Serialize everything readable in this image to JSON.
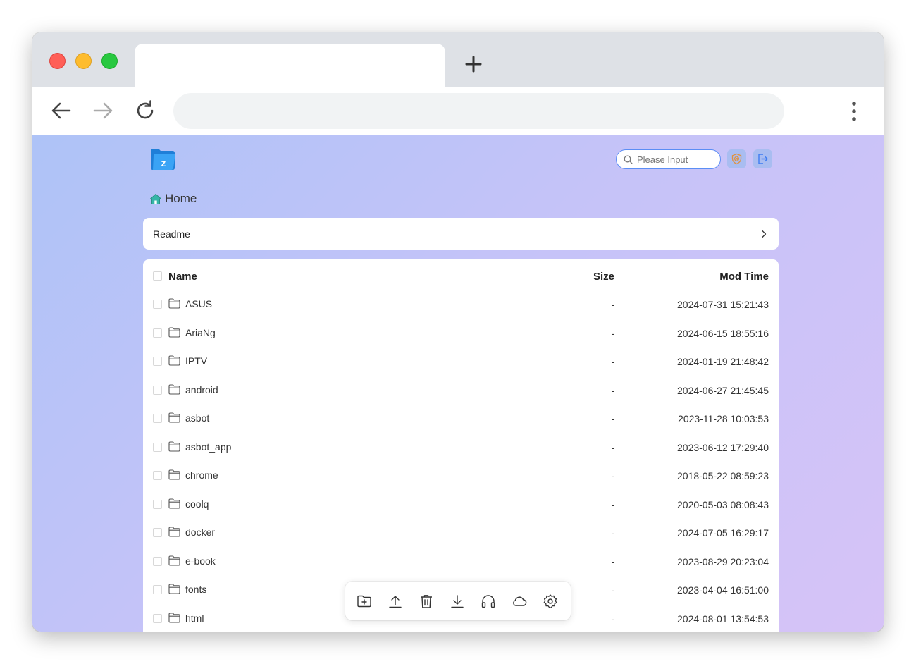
{
  "browser": {
    "tab_title": "",
    "address": ""
  },
  "app": {
    "search_placeholder": "Please Input",
    "logo_letter": "z",
    "breadcrumb_home": "Home",
    "readme_label": "Readme"
  },
  "table": {
    "headers": {
      "name": "Name",
      "size": "Size",
      "modified": "Mod Time"
    },
    "rows": [
      {
        "name": "ASUS",
        "size": "-",
        "modified": "2024-07-31 15:21:43"
      },
      {
        "name": "AriaNg",
        "size": "-",
        "modified": "2024-06-15 18:55:16"
      },
      {
        "name": "IPTV",
        "size": "-",
        "modified": "2024-01-19 21:48:42"
      },
      {
        "name": "android",
        "size": "-",
        "modified": "2024-06-27 21:45:45"
      },
      {
        "name": "asbot",
        "size": "-",
        "modified": "2023-11-28 10:03:53"
      },
      {
        "name": "asbot_app",
        "size": "-",
        "modified": "2023-06-12 17:29:40"
      },
      {
        "name": "chrome",
        "size": "-",
        "modified": "2018-05-22 08:59:23"
      },
      {
        "name": "coolq",
        "size": "-",
        "modified": "2020-05-03 08:08:43"
      },
      {
        "name": "docker",
        "size": "-",
        "modified": "2024-07-05 16:29:17"
      },
      {
        "name": "e-book",
        "size": "-",
        "modified": "2023-08-29 20:23:04"
      },
      {
        "name": "fonts",
        "size": "-",
        "modified": "2023-04-04 16:51:00"
      },
      {
        "name": "html",
        "size": "-",
        "modified": "2024-08-01 13:54:53"
      }
    ]
  },
  "bottom_toolbar": {
    "icons": [
      "new-folder-icon",
      "upload-icon",
      "delete-icon",
      "download-icon",
      "headphones-icon",
      "cloud-icon",
      "settings-icon"
    ]
  },
  "colors": {
    "accent": "#2f8de4",
    "search_border": "#5b8ef5",
    "gradient_start": "#aec3f7",
    "gradient_end": "#d6c3f7"
  }
}
